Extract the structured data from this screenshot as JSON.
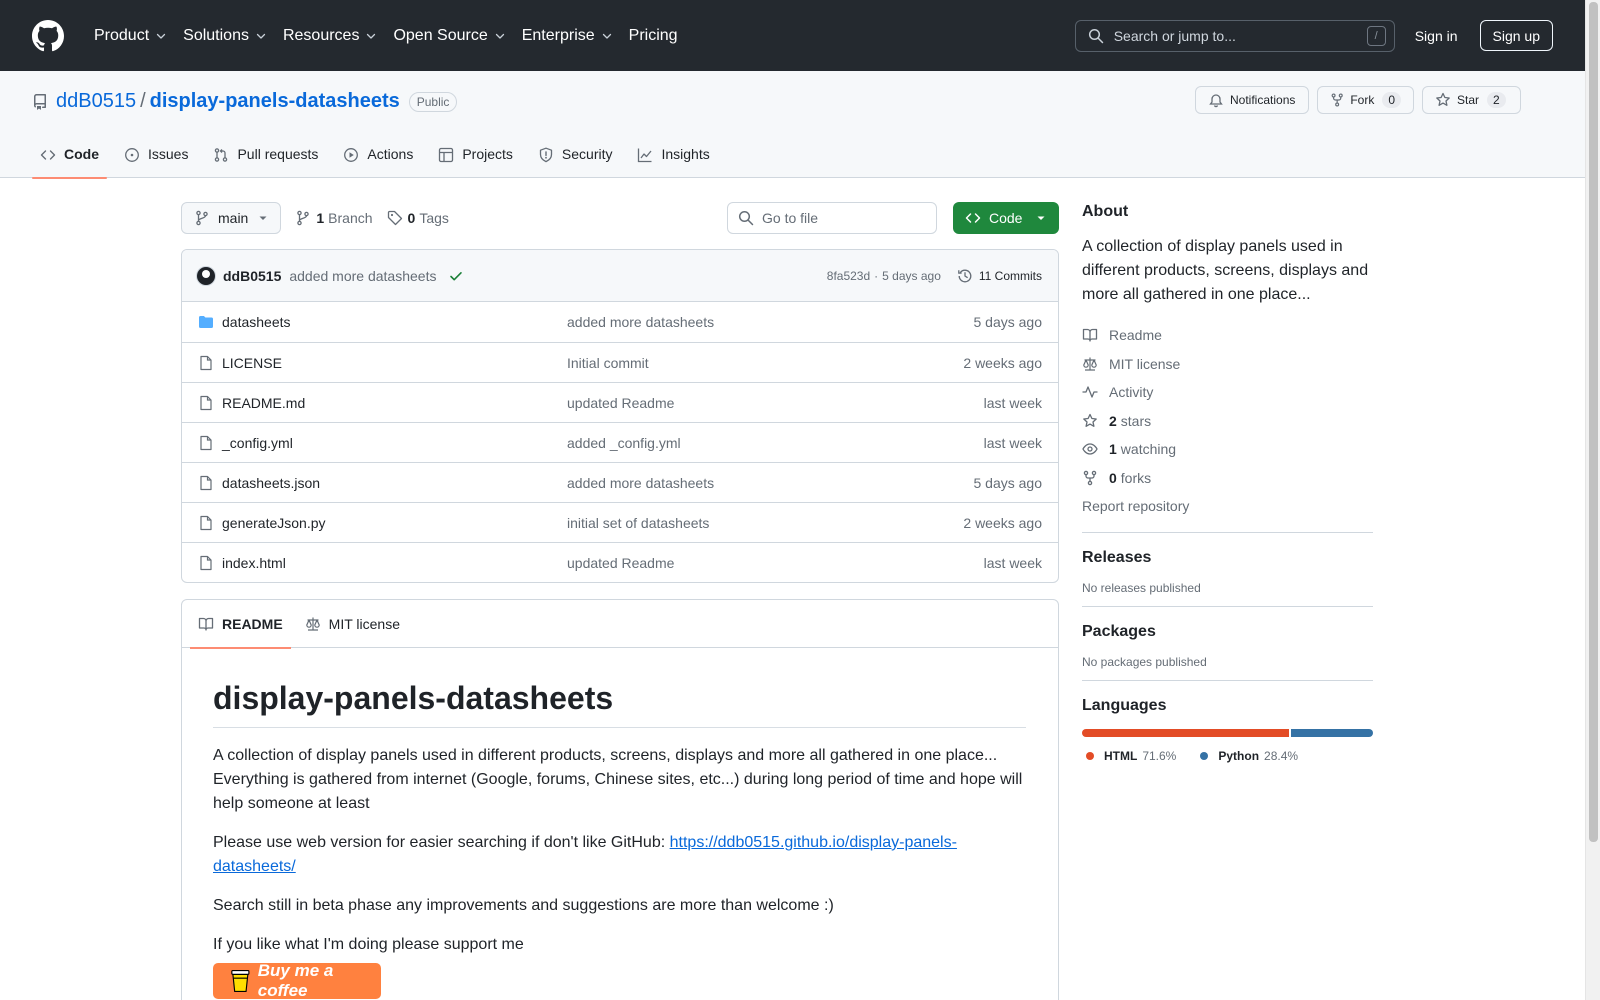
{
  "header": {
    "nav": [
      {
        "label": "Product",
        "has_menu": true
      },
      {
        "label": "Solutions",
        "has_menu": true
      },
      {
        "label": "Resources",
        "has_menu": true
      },
      {
        "label": "Open Source",
        "has_menu": true
      },
      {
        "label": "Enterprise",
        "has_menu": true
      },
      {
        "label": "Pricing",
        "has_menu": false
      }
    ],
    "search_placeholder": "Search or jump to...",
    "search_shortcut": "/",
    "sign_in": "Sign in",
    "sign_up": "Sign up"
  },
  "repo": {
    "owner": "ddB0515",
    "separator": "/",
    "name": "display-panels-datasheets",
    "visibility": "Public",
    "actions": {
      "notifications": "Notifications",
      "fork": "Fork",
      "fork_count": "0",
      "star": "Star",
      "star_count": "2"
    },
    "tabs": [
      "Code",
      "Issues",
      "Pull requests",
      "Actions",
      "Projects",
      "Security",
      "Insights"
    ],
    "active_tab": "Code"
  },
  "toolbar": {
    "branch": "main",
    "branch_count": "1",
    "branch_label": "Branch",
    "tag_count": "0",
    "tag_label": "Tags",
    "go_to_file": "Go to file",
    "code_button": "Code"
  },
  "latest_commit": {
    "author": "ddB0515",
    "message": "added more datasheets",
    "hash": "8fa523d",
    "separator": "·",
    "time": "5 days ago",
    "commits_label": "11 Commits"
  },
  "files": [
    {
      "name": "datasheets",
      "type": "folder",
      "message": "added more datasheets",
      "date": "5 days ago"
    },
    {
      "name": "LICENSE",
      "type": "file",
      "message": "Initial commit",
      "date": "2 weeks ago"
    },
    {
      "name": "README.md",
      "type": "file",
      "message": "updated Readme",
      "date": "last week"
    },
    {
      "name": "_config.yml",
      "type": "file",
      "message": "added _config.yml",
      "date": "last week"
    },
    {
      "name": "datasheets.json",
      "type": "file",
      "message": "added more datasheets",
      "date": "5 days ago"
    },
    {
      "name": "generateJson.py",
      "type": "file",
      "message": "initial set of datasheets",
      "date": "2 weeks ago"
    },
    {
      "name": "index.html",
      "type": "file",
      "message": "updated Readme",
      "date": "last week"
    }
  ],
  "readme": {
    "tabs": [
      "README",
      "MIT license"
    ],
    "title": "display-panels-datasheets",
    "p1_line1": "A collection of display panels used in different products, screens, displays and more all gathered in one place...",
    "p1_line2": "Everything is gathered from internet (Google, forums, Chinese sites, etc...) during long period of time and hope will help someone at least",
    "p2_text": "Please use web version for easier searching if don't like GitHub: ",
    "p2_link": "https://ddb0515.github.io/display-panels-datasheets/",
    "p3": "Search still in beta phase any improvements and suggestions are more than welcome :)",
    "p4": "If you like what I'm doing please support me",
    "coffee_button": "Buy me a coffee"
  },
  "sidebar": {
    "about_title": "About",
    "description": "A collection of display panels used in different products, screens, displays and more all gathered in one place...",
    "links": [
      {
        "icon": "book-icon",
        "count": "",
        "label": "Readme"
      },
      {
        "icon": "law-icon",
        "count": "",
        "label": "MIT license"
      },
      {
        "icon": "pulse-icon",
        "count": "",
        "label": "Activity"
      },
      {
        "icon": "star-icon",
        "count": "2",
        "label": "stars"
      },
      {
        "icon": "eye-icon",
        "count": "1",
        "label": "watching"
      },
      {
        "icon": "fork-icon",
        "count": "0",
        "label": "forks"
      }
    ],
    "report": "Report repository",
    "releases_title": "Releases",
    "releases_text": "No releases published",
    "packages_title": "Packages",
    "packages_text": "No packages published",
    "languages_title": "Languages",
    "languages": [
      {
        "name": "HTML",
        "percent": "71.6%",
        "value": 71.6,
        "color": "#e34c26"
      },
      {
        "name": "Python",
        "percent": "28.4%",
        "value": 28.4,
        "color": "#3572a5"
      }
    ]
  },
  "colors": {
    "header_bg": "#24292f",
    "link": "#0969da",
    "primary_button": "#1f883d",
    "active_tab_underline": "#fd8c73",
    "coffee": "#ff813f"
  }
}
